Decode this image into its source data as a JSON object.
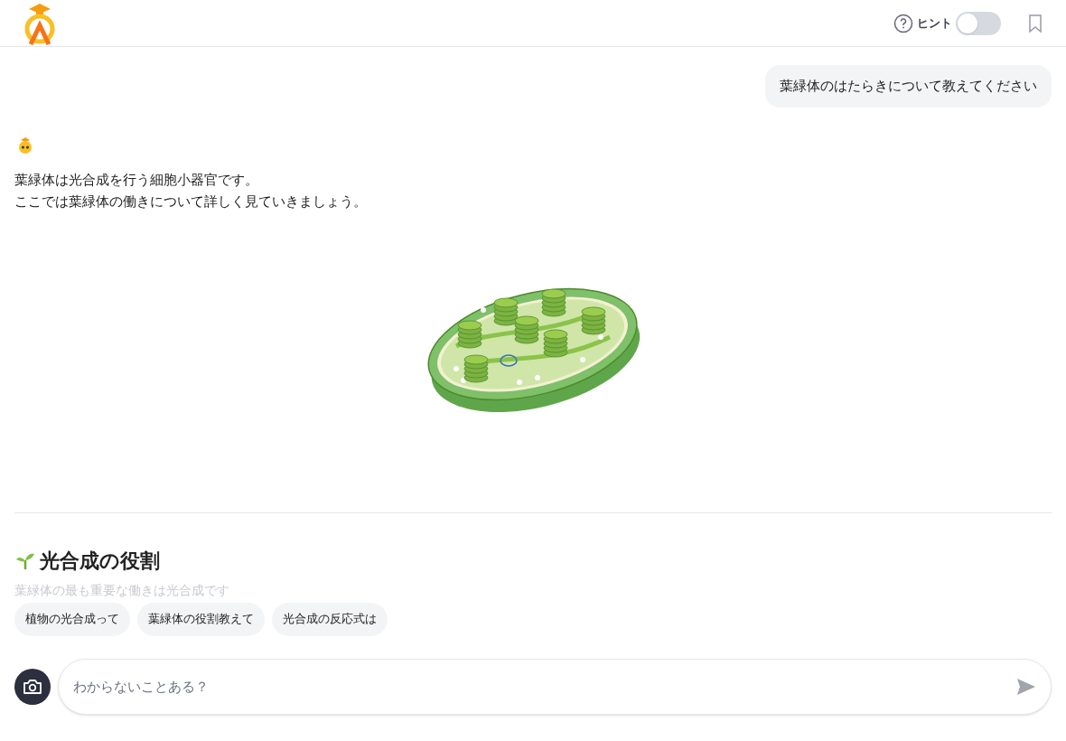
{
  "header": {
    "hint": {
      "label": "ヒント",
      "on": false
    }
  },
  "user_message": {
    "text": "葉緑体のはたらきについて教えてください"
  },
  "bot_message": {
    "lines": [
      "葉緑体は光合成を行う細胞小器官です。",
      "ここでは葉緑体の働きについて詳しく見ていきましょう。"
    ],
    "section_title": "光合成の役割",
    "section_text": "葉緑体の最も重要な働きは光合成です"
  },
  "suggestions": [
    "植物の光合成って",
    "葉緑体の役割教えて",
    "光合成の反応式は"
  ],
  "input": {
    "placeholder": "わからないことある？"
  }
}
